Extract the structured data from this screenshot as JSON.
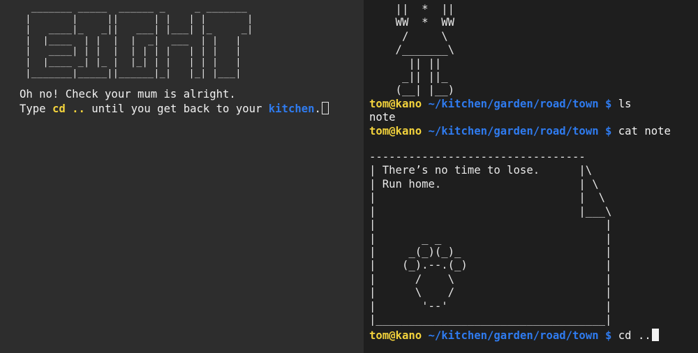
{
  "left_pane": {
    "banner_lines": [
      "  _______ _____  ______ _     _ _______",
      " |       |     ||      | |   | |       |",
      " |   ____|_   _||   ___| |___| |_     _|",
      " |  |____  | |  |  |  _|  ___  | |   |",
      " |   ____| | |  |  | | | |   | | |   |",
      " |  |____ _| |_ |  |_| | |   | | |   |",
      " |_______|_____||______|_|   |_| |___|"
    ],
    "message_line1": "Oh no! Check your mum is alright.",
    "message_line2_prefix": "Type ",
    "message_line2_cmd": "cd ..",
    "message_line2_middle": " until you get back to your ",
    "message_line2_target": "kitchen",
    "message_line2_suffix": "."
  },
  "right_pane": {
    "ascii_figure": "    ||  *  ||\n    WW  *  WW\n     /     \\\n    /_______\\\n      || ||\n     _|| ||_\n    (__| |__)",
    "prompt_user": "tom@kano",
    "prompt_path": "~/kitchen/garden/road/town",
    "prompt_sign": "$",
    "history": [
      {
        "command": "ls",
        "output": "note"
      },
      {
        "command": "cat note",
        "output": ""
      }
    ],
    "note_box": "---------------------------------\n| There’s no time to lose.      |\\\n| Run home.                     | \\\n|                               |  \\\n|                               |___\\\n|                                   |\n|       _ _                         |\n|     _(_)(_)_                      |\n|    (_).--.(_)                     |\n|      /    \\                       |\n|      \\    /                       |\n|       '--'                        |\n|___________________________________|",
    "current_command": "cd .."
  },
  "colors": {
    "left_bg": "#2d2d2d",
    "right_bg": "#1e1e1e",
    "prompt_user": "#f2d23c",
    "prompt_path": "#2f7bef",
    "text": "#f2f2f2"
  }
}
